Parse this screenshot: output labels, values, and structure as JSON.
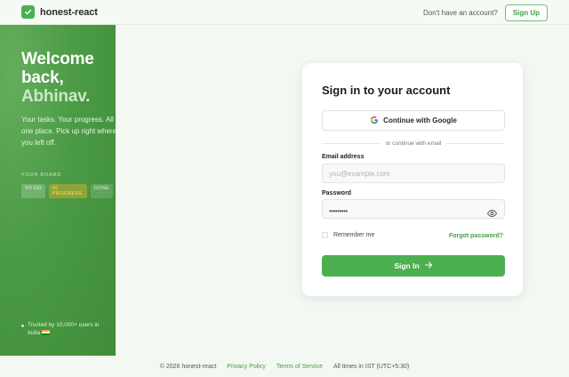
{
  "header": {
    "brand": "honest-react",
    "account_prompt": "Don't have an account?",
    "signup_label": "Sign Up",
    "logo_icon": "check-icon"
  },
  "hero": {
    "title_line1": "Welcome",
    "title_line2": "back,",
    "name": "Abhinav.",
    "subtitle": "Your tasks. Your progress. All in one place. Pick up right where you left off.",
    "board_label": "YOUR BOARD",
    "tags": [
      "TO DO",
      "IN PROGRESS",
      "DONE"
    ],
    "trusted_text": "Trusted by 10,000+ users in India"
  },
  "signin": {
    "title": "Sign in to your account",
    "google_label": "Continue with Google",
    "divider_text": "or continue with email",
    "email_label": "Email address",
    "email_placeholder": "you@example.com",
    "password_label": "Password",
    "password_mask": "•••••••••",
    "remember_label": "Remember me",
    "forgot_label": "Forgot password?",
    "submit_label": "Sign In"
  },
  "footer": {
    "copyright": "© 2026 honest-react",
    "privacy": "Privacy Policy",
    "terms": "Terms of Service",
    "timezone": "All times in IST (UTC+5:30)"
  },
  "colors": {
    "accent": "#4caf50",
    "hero_green": "#4b9a45",
    "background": "#f3f8f2"
  },
  "icons": {
    "google": "google-icon",
    "eye": "eye-icon",
    "arrow": "arrow-right-icon",
    "flag": "india-flag-icon"
  }
}
